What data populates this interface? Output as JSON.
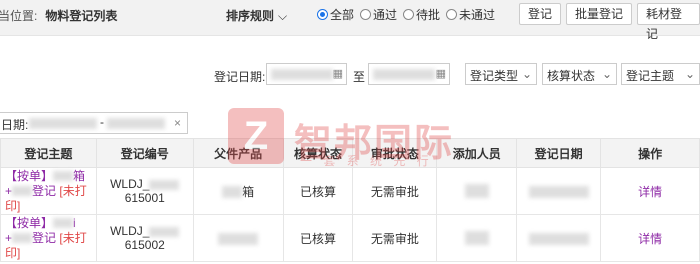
{
  "header": {
    "location_label": "当位置:",
    "page_title": "物料登记列表",
    "sort_label": "排序规则",
    "filter_options": [
      "全部",
      "通过",
      "待批",
      "未通过"
    ],
    "selected_filter": "全部",
    "buttons": {
      "register": "登记",
      "batch_register": "批量登记",
      "consumable_register": "耗材登记"
    }
  },
  "filters": {
    "register_date_label": "登记日期:",
    "to_label": "至",
    "register_type": "登记类型",
    "audit_status": "核算状态",
    "register_subject": "登记主题",
    "range_label": "日期:"
  },
  "table": {
    "columns": [
      "登记主题",
      "登记编号",
      "父件产品",
      "核算状态",
      "审批状态",
      "添加人员",
      "登记日期",
      "操作"
    ],
    "rows": [
      {
        "subject_prefix": "【按单】",
        "subject_suffix": "箱",
        "subject_line2": "+",
        "subject_register": "登记",
        "subject_tag": "[未打",
        "subject_tag2": "印]",
        "code_prefix": "WLDJ_",
        "code_suffix": "615001",
        "product": "箱",
        "audit": "已核算",
        "approval": "无需审批",
        "action": "详情"
      },
      {
        "subject_prefix": "【按单】",
        "subject_suffix": "i",
        "subject_line2": "+",
        "subject_register": "登记",
        "subject_tag": "[未打",
        "subject_tag2": "印]",
        "code_prefix": "WLDJ_",
        "code_suffix": "615002",
        "product": "",
        "audit": "已核算",
        "approval": "无需审批",
        "action": "详情"
      }
    ]
  },
  "watermark": {
    "logo_letter": "Z",
    "brand": "智邦国际",
    "slogan": "一 套 系 统 先 行"
  },
  "colors": {
    "accent": "#1a73e8",
    "link_purple": "#8e2aa6",
    "red": "#e04848",
    "watermark": "#e14b4b"
  }
}
